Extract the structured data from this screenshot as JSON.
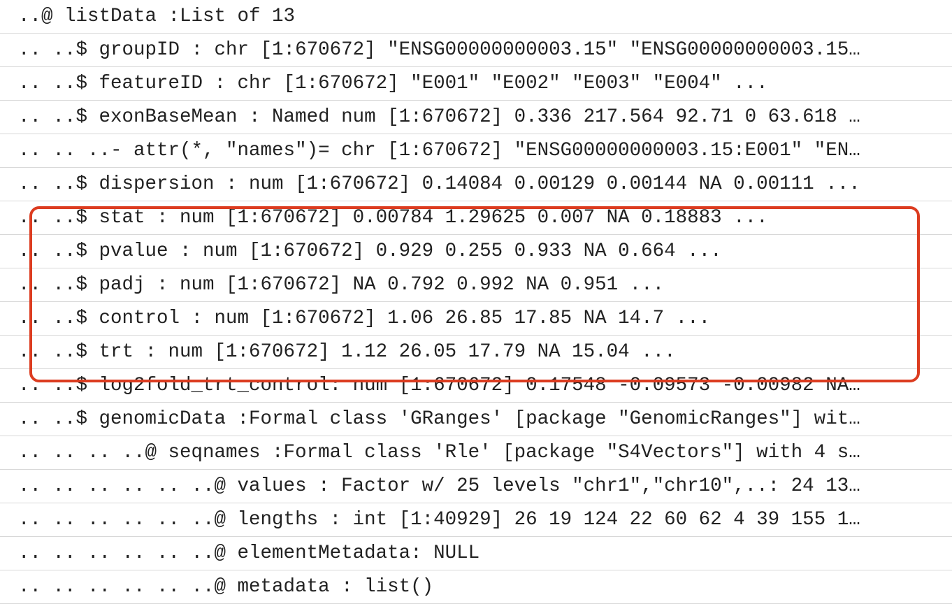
{
  "lines": [
    "..@ listData :List of 13",
    ".. ..$ groupID : chr [1:670672] \"ENSG00000000003.15\" \"ENSG00000000003.15…",
    ".. ..$ featureID : chr [1:670672] \"E001\" \"E002\" \"E003\" \"E004\" ...",
    ".. ..$ exonBaseMean : Named num [1:670672] 0.336 217.564 92.71 0 63.618 …",
    ".. .. ..- attr(*, \"names\")= chr [1:670672] \"ENSG00000000003.15:E001\" \"EN…",
    ".. ..$ dispersion : num [1:670672] 0.14084 0.00129 0.00144 NA 0.00111 ...",
    ".. ..$ stat : num [1:670672] 0.00784 1.29625 0.007 NA 0.18883 ...",
    ".. ..$ pvalue : num [1:670672] 0.929 0.255 0.933 NA 0.664 ...",
    ".. ..$ padj : num [1:670672] NA 0.792 0.992 NA 0.951 ...",
    ".. ..$ control : num [1:670672] 1.06 26.85 17.85 NA 14.7 ...",
    ".. ..$ trt : num [1:670672] 1.12 26.05 17.79 NA 15.04 ...",
    ".. ..$ log2fold_trt_control: num [1:670672] 0.17548 -0.09573 -0.00982 NA…",
    ".. ..$ genomicData :Formal class 'GRanges' [package \"GenomicRanges\"] wit…",
    ".. .. .. ..@ seqnames :Formal class 'Rle' [package \"S4Vectors\"] with 4 s…",
    ".. .. .. .. .. ..@ values : Factor w/ 25 levels \"chr1\",\"chr10\",..: 24 13…",
    ".. .. .. .. .. ..@ lengths : int [1:40929] 26 19 124 22 60 62 4 39 155 1…",
    ".. .. .. .. .. ..@ elementMetadata: NULL",
    ".. .. .. .. .. ..@ metadata : list()"
  ],
  "highlight": {
    "start": 7,
    "end": 11
  }
}
